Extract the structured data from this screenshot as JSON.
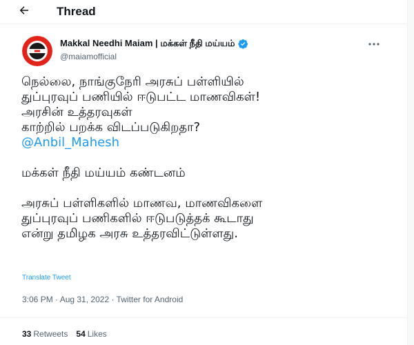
{
  "header": {
    "back_icon": "arrow-left-icon",
    "title": "Thread"
  },
  "author": {
    "name": "Makkal Needhi Maiam | மக்கள் நீதி மய்யம்",
    "handle": "@maiamofficial",
    "verified_icon": "verified-badge-icon",
    "avatar_icon": "party-logo-avatar",
    "more_icon": "more-horizontal-icon"
  },
  "tweet": {
    "lines": [
      "நெல்லை, நாங்குநேரி அரசுப் பள்ளியில்",
      "துப்புரவுப் பணியில் ஈடுபட்ட மாணவிகள்!",
      "அரசின் உத்தரவுகள்",
      "காற்றில் பறக்க விடப்படுகிறதா?"
    ],
    "mention": "@Anbil_Mahesh",
    "line_condemn": "மக்கள் நீதி மய்யம் கண்டனம்",
    "lines_end": [
      "அரசுப் பள்ளிகளில் மாணவ, மாணவிகளை",
      "துப்புரவுப் பணிகளில் ஈடுபடுத்தக் கூடாது",
      "என்று தமிழக அரசு உத்தரவிட்டுள்ளது."
    ],
    "translate_label": "Translate Tweet"
  },
  "meta": {
    "time": "3:06 PM",
    "separator": " · ",
    "date": "Aug 31, 2022",
    "source": "Twitter for Android"
  },
  "stats": {
    "retweets_count": "33",
    "retweets_label": "Retweets",
    "likes_count": "54",
    "likes_label": "Likes"
  },
  "colors": {
    "accent": "#1d9bf0",
    "text": "#0f1419",
    "secondary": "#536471",
    "divider": "#eff3f4",
    "logo_red": "#e2231a"
  }
}
